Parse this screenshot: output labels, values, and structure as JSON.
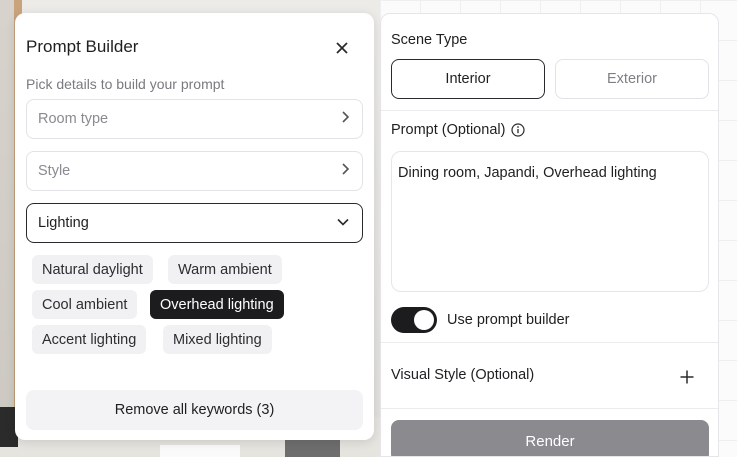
{
  "prompt_builder": {
    "title": "Prompt Builder",
    "subtitle": "Pick details to build your prompt",
    "fields": [
      {
        "label": "Room type",
        "state": "collapsed"
      },
      {
        "label": "Style",
        "state": "collapsed"
      },
      {
        "label": "Lighting",
        "state": "expanded"
      }
    ],
    "lighting_options": [
      {
        "label": "Natural daylight",
        "selected": false
      },
      {
        "label": "Warm ambient",
        "selected": false
      },
      {
        "label": "Cool ambient",
        "selected": false
      },
      {
        "label": "Overhead lighting",
        "selected": true
      },
      {
        "label": "Accent lighting",
        "selected": false
      },
      {
        "label": "Mixed lighting",
        "selected": false
      }
    ],
    "remove_all_label": "Remove all keywords (3)"
  },
  "settings": {
    "scene_type_label": "Scene Type",
    "scene_options": [
      {
        "label": "Interior",
        "selected": true
      },
      {
        "label": "Exterior",
        "selected": false
      }
    ],
    "prompt_label": "Prompt (Optional)",
    "prompt_value": "Dining room, Japandi, Overhead lighting",
    "use_prompt_builder_label": "Use prompt builder",
    "use_prompt_builder_on": true,
    "visual_style_label": "Visual Style (Optional)",
    "render_label": "Render"
  },
  "icons": {
    "close": "close-icon",
    "chevron_right": "chevron-right-icon",
    "chevron_down": "chevron-down-icon",
    "info": "info-icon",
    "plus": "plus-icon"
  },
  "colors": {
    "accent_dark": "#1c1c1f",
    "render_button": "#8a8a8f"
  }
}
